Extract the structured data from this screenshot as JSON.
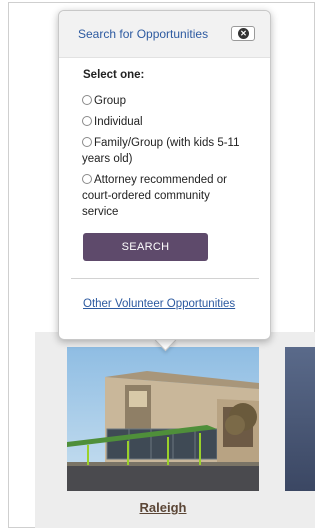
{
  "popover": {
    "title": "Search for Opportunities",
    "close_icon": "close-icon",
    "select_label": "Select one:",
    "options": [
      {
        "label": "Group"
      },
      {
        "label": "Individual"
      },
      {
        "label": "Family/Group (with kids 5-11 years old)"
      },
      {
        "label": "Attorney recommended or court-ordered community service"
      }
    ],
    "search_button": "SEARCH",
    "other_link": "Other Volunteer Opportunities"
  },
  "locations": [
    {
      "name": "Raleigh"
    }
  ],
  "colors": {
    "accent_button": "#5e4a6b",
    "link": "#2d5aa0",
    "location_link": "#5b4636"
  }
}
